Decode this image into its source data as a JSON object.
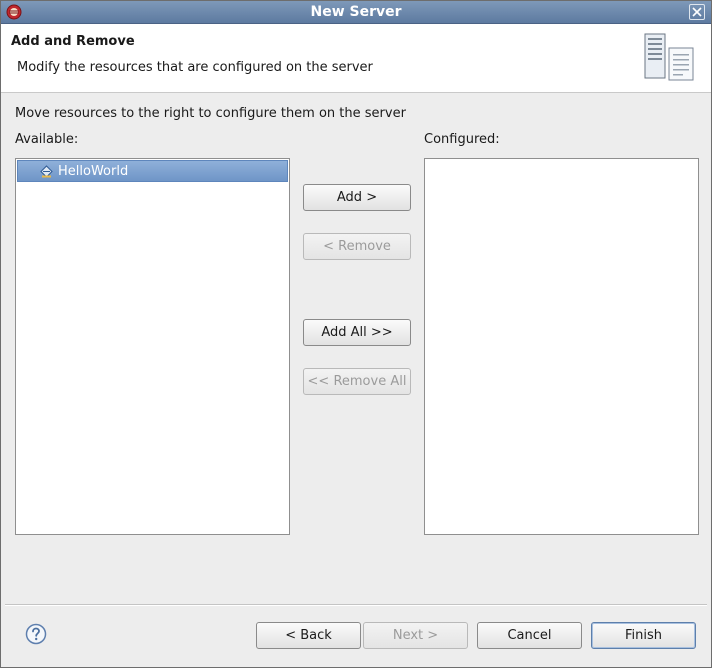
{
  "window": {
    "title": "New Server",
    "app_icon": "eclipse-icon",
    "close_icon": "close-icon"
  },
  "header": {
    "title": "Add and Remove",
    "description": "Modify the resources that are configured on the server",
    "icon": "server-icon"
  },
  "main": {
    "instructions": "Move resources to the right to configure them on the server",
    "available_label": "Available:",
    "configured_label": "Configured:",
    "available_items": [
      {
        "label": "HelloWorld",
        "icon": "web-project-icon",
        "selected": true
      }
    ],
    "configured_items": []
  },
  "buttons": {
    "add": "Add >",
    "remove": "< Remove",
    "add_all": "Add All >>",
    "remove_all": "<< Remove All"
  },
  "footer": {
    "help_icon": "help-icon",
    "back": "< Back",
    "next": "Next >",
    "cancel": "Cancel",
    "finish": "Finish"
  },
  "colors": {
    "title_bar": "#6b88ad",
    "selection": "#7a9ccb",
    "disabled_text": "#9b9b9b"
  }
}
